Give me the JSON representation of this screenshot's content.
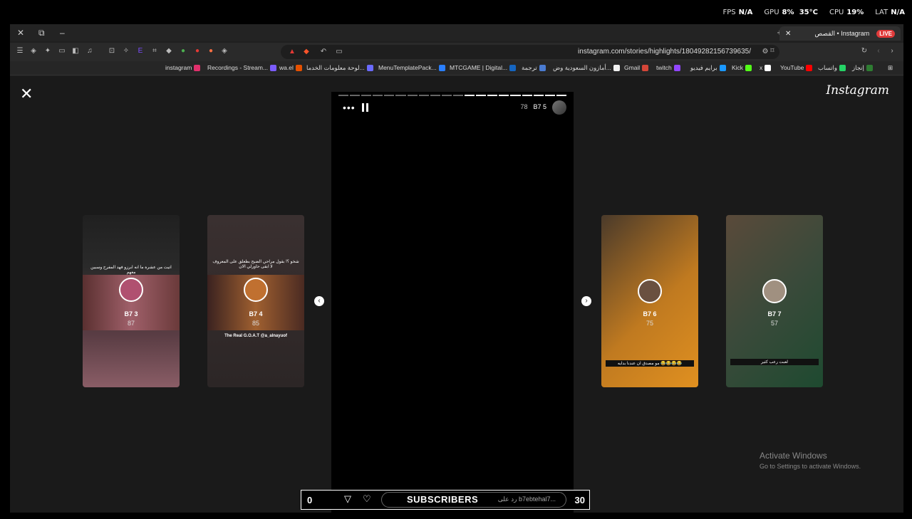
{
  "overlay": {
    "fps_label": "FPS",
    "fps_value": "N/A",
    "gpu_label": "GPU",
    "gpu_value": "8%",
    "gpu_temp": "35°C",
    "cpu_label": "CPU",
    "cpu_value": "19%",
    "lat_label": "LAT",
    "lat_value": "N/A"
  },
  "browser": {
    "tab_title": "القصص • Instagram",
    "tab_badge": "LIVE",
    "url": "instagram.com/stories/highlights/18049282156739635/",
    "bookmarks": [
      {
        "label": "instagram",
        "color": "#e1306c"
      },
      {
        "label": "Recordings - Stream...",
        "color": "#7b5cff"
      },
      {
        "label": "wa.el",
        "color": "#e65100"
      },
      {
        "label": "لوحة معلومات الخدما...",
        "color": "#6a6aff"
      },
      {
        "label": "MenuTemplatePack...",
        "color": "#2a7fff"
      },
      {
        "label": "MTCGAME | Digital...",
        "color": "#1565c0"
      },
      {
        "label": "ترجمة",
        "color": "#4a7bd1"
      },
      {
        "label": "أمازون السعودية وض...",
        "color": "#f0f0f0"
      },
      {
        "label": "Gmail",
        "color": "#d44638"
      },
      {
        "label": "twitch",
        "color": "#9146ff"
      },
      {
        "label": "برايم فيديو",
        "color": "#1a98ff"
      },
      {
        "label": "Kick",
        "color": "#53fc18"
      },
      {
        "label": "x",
        "color": "#ffffff"
      },
      {
        "label": "YouTube",
        "color": "#ff0000"
      },
      {
        "label": "واتساب",
        "color": "#25d366"
      },
      {
        "label": "إنجاز",
        "color": "#2e7d32"
      }
    ]
  },
  "page": {
    "logo": "Instagram",
    "main_story": {
      "name": "B7 5",
      "count": "78",
      "progress_done": 9,
      "progress_total": 20
    },
    "side_stories": [
      {
        "name": "B7 3",
        "count": "87",
        "caption": "اتيت من عشرة ما انه ابرزو فهد المفرح وسبين معهم"
      },
      {
        "name": "B7 4",
        "count": "85",
        "caption": "شخو ؟! بقول مراحي الضيح بطعلق على المعروف لا ابقى حاورلي الان",
        "caption2": "The Real G.O.A.T @a_alnayuof"
      },
      {
        "name": "B7 6",
        "count": "75",
        "caption": "مو مصدق ان عندنا بدايه 😂😂😂😂"
      },
      {
        "name": "B7 7",
        "count": "57",
        "caption": "لعبت رعب كثير"
      }
    ],
    "windows_notice": {
      "title": "Activate Windows",
      "subtitle": "Go to Settings to activate Windows."
    }
  },
  "stream_bar": {
    "left_count": "0",
    "right_count": "30",
    "label": "SUBSCRIBERS",
    "reply_placeholder": "رد على b7ebtehal7..."
  }
}
